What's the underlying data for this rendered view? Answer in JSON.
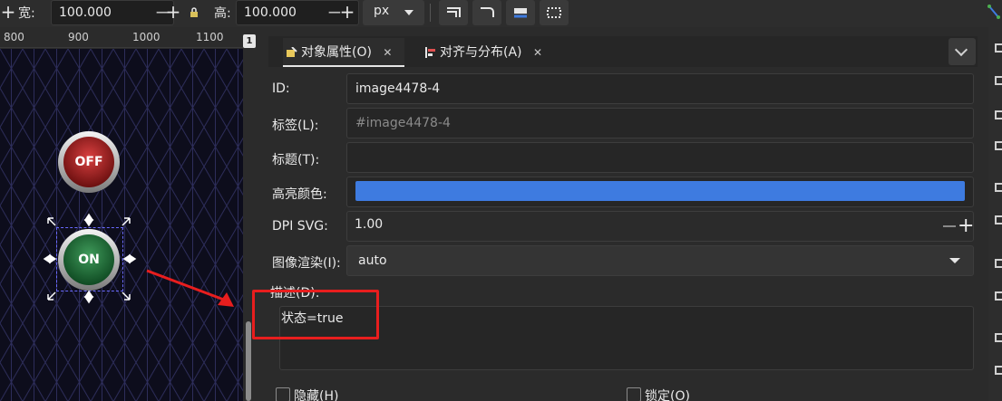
{
  "toolbar": {
    "width_label": "宽:",
    "width_value": "100.000",
    "height_label": "高:",
    "height_value": "100.000",
    "unit": "px",
    "minus": "−",
    "plus": "+"
  },
  "ruler": {
    "ticks": [
      "800",
      "900",
      "1000",
      "1100"
    ],
    "page_badge": "1"
  },
  "canvas": {
    "button_off_label": "OFF",
    "button_on_label": "ON"
  },
  "tabs": [
    {
      "label": "对象属性(O)",
      "close": "✕"
    },
    {
      "label": "对齐与分布(A)",
      "close": "✕"
    }
  ],
  "form": {
    "id_label": "ID:",
    "id_value": "image4478-4",
    "tag_label": "标签(L):",
    "tag_placeholder": "#image4478-4",
    "title_label": "标题(T):",
    "title_value": "",
    "highlight_label": "高亮颜色:",
    "highlight_color": "#3e7be0",
    "dpi_label": "DPI SVG:",
    "dpi_value": "1.00",
    "render_label": "图像渲染(I):",
    "render_value": "auto",
    "desc_label": "描述(D):",
    "desc_value": "状态=true",
    "hidden_label": "隐藏(H)",
    "locked_label": "锁定(O)"
  },
  "colors": {
    "annotation": "#e81e1e",
    "highlight": "#3e7be0"
  }
}
